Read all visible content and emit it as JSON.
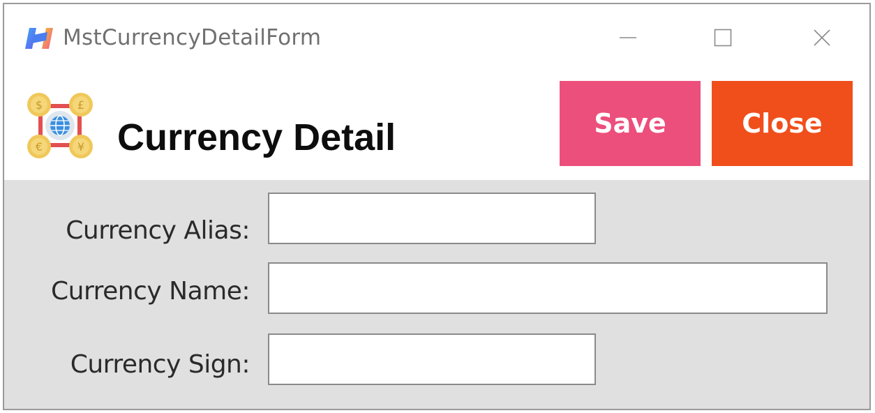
{
  "window": {
    "title": "MstCurrencyDetailForm",
    "controls": {
      "minimize_icon": "minimize-icon",
      "maximize_icon": "maximize-icon",
      "close_icon": "close-icon"
    }
  },
  "header": {
    "icon": "currency-exchange-icon",
    "title": "Currency Detail",
    "save_label": "Save",
    "close_label": "Close"
  },
  "form": {
    "fields": [
      {
        "label": "Currency Alias:",
        "value": ""
      },
      {
        "label": "Currency Name:",
        "value": ""
      },
      {
        "label": "Currency Sign:",
        "value": ""
      }
    ]
  },
  "colors": {
    "save_button": "#ec4f7c",
    "close_button": "#f04f1c",
    "form_background": "#e0e0e0"
  }
}
